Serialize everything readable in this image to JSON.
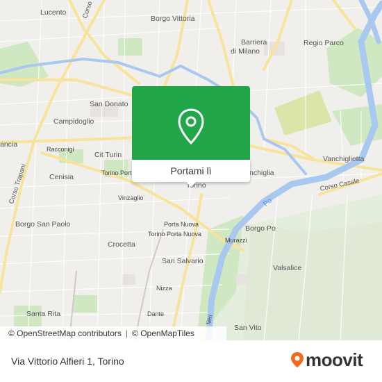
{
  "map": {
    "labels": {
      "lucento": "Lucento",
      "corso_potenza": "Corso Potenza",
      "borgo_vittoria": "Borgo Vittoria",
      "barriera_di_milano_1": "Barriera",
      "barriera_di_milano_2": "di Milano",
      "regio_parco": "Regio Parco",
      "san_donato": "San Donato",
      "campidoglio": "Campidoglio",
      "francia": "ancia",
      "racconigi": "Racconigi",
      "cit_turin": "Cit Turin",
      "corso_trapani": "Corso Trapani",
      "cenisia": "Cenisia",
      "torino_porta_susa": "Torino Porta",
      "vanchiglia": "nchiglia",
      "vanchiglietta": "Vanchiglietta",
      "corso_casale": "Corso Casale",
      "torino": "Torino",
      "vinzaglio": "Vinzaglio",
      "po": "Po",
      "borgo_san_paolo": "Borgo San Paolo",
      "porta_nuova": "Porta Nuova",
      "torino_porta_nuova": "Torino Porta Nuova",
      "murazzi": "Murazzi",
      "borgo_po": "Borgo Po",
      "crocetta": "Crocetta",
      "san_salvario": "San Salvario",
      "valsalice": "Valsalice",
      "nizza": "Nizza",
      "santa_rita": "Santa Rita",
      "dante": "Dante",
      "san_vito": "San Vito",
      "lungo_po": "lieri"
    },
    "popup": {
      "button_label": "Portami lì",
      "icon": "location-pin-icon"
    },
    "attribution": {
      "osm_contributors": "© OpenStreetMap contributors",
      "openmaptiles": "© OpenMapTiles",
      "separator": "|"
    }
  },
  "footer": {
    "address": "Via Vittorio Alfieri 1, Torino",
    "brand": "moovit"
  },
  "colors": {
    "popup_green": "#22a64a",
    "brand_orange": "#f26a21",
    "river": "#a8c8f0",
    "park": "#cfe8c2",
    "road_major": "#f7e39a"
  }
}
